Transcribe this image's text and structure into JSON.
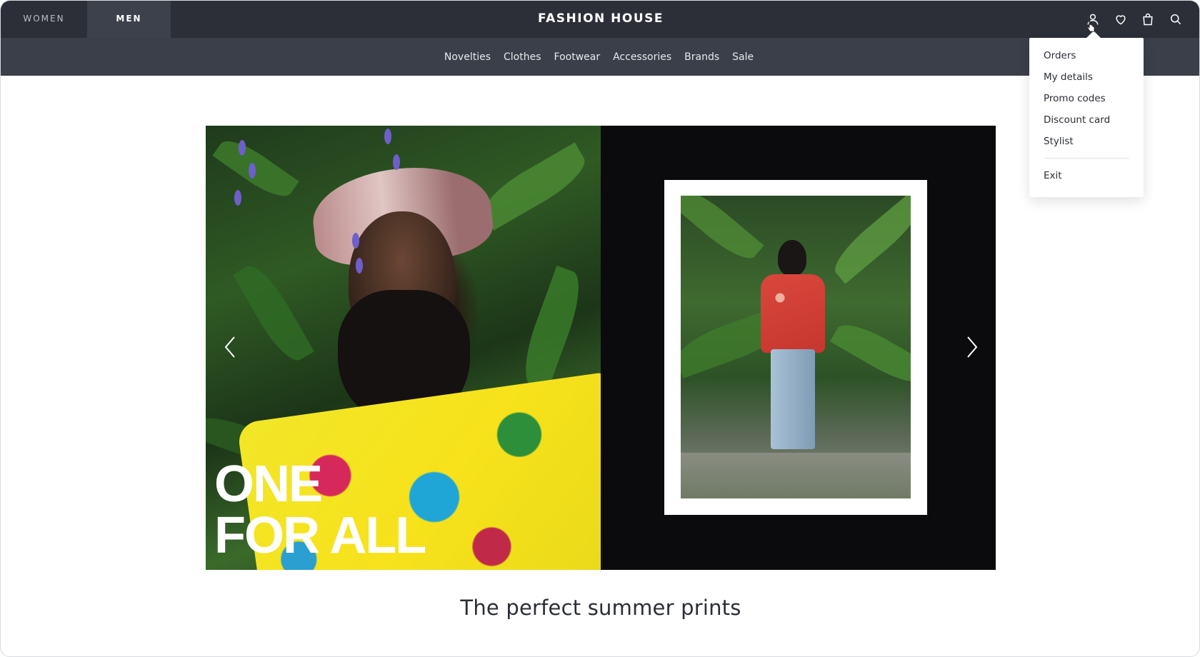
{
  "header": {
    "gender_tabs": [
      {
        "label": "WOMEN",
        "active": false
      },
      {
        "label": "MEN",
        "active": true
      }
    ],
    "brand": "FASHION HOUSE",
    "icons": [
      "user-icon",
      "heart-icon",
      "bag-icon",
      "search-icon"
    ]
  },
  "nav": {
    "categories": [
      "Novelties",
      "Clothes",
      "Footwear",
      "Accessories",
      "Brands",
      "Sale"
    ]
  },
  "account_menu": {
    "items": [
      "Orders",
      "My details",
      "Promo codes",
      "Discount card",
      "Stylist"
    ],
    "exit": "Exit"
  },
  "banner": {
    "headline_line1": "ONE",
    "headline_line2": "FOR ALL",
    "caption": "The perfect summer prints"
  },
  "colors": {
    "topbar": "#2c2f38",
    "catbar": "#3b3f49",
    "active_tab": "#3d414c",
    "banner_bg": "#0b0a0c"
  }
}
